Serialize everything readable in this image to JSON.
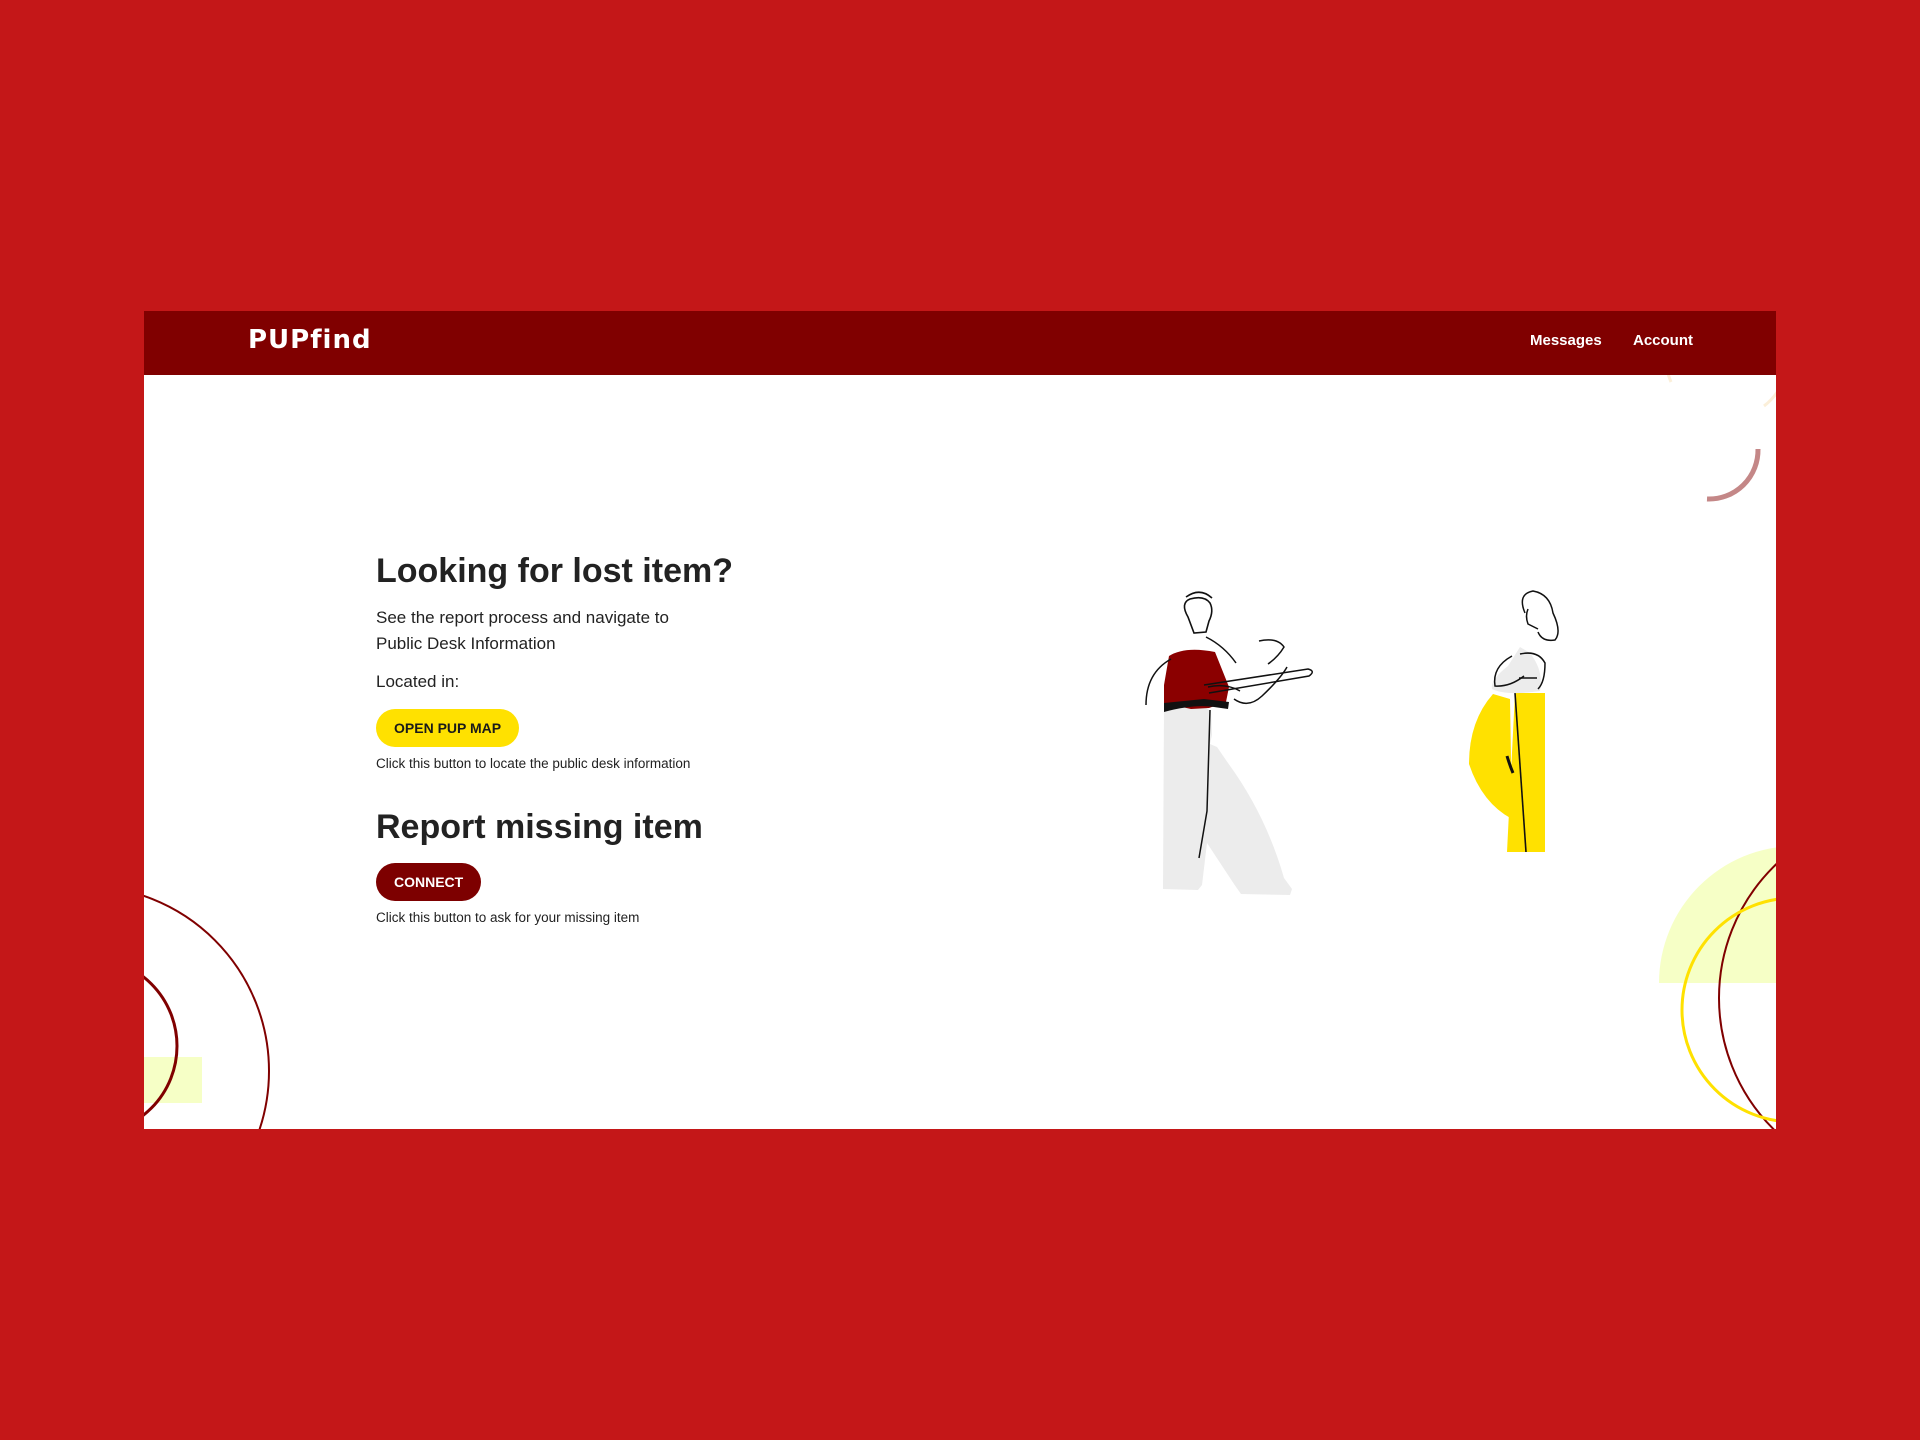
{
  "app": {
    "logo": "PUPfind"
  },
  "nav": {
    "messages": "Messages",
    "account": "Account"
  },
  "lost": {
    "title": "Looking for lost item?",
    "description": "See the report process and navigate to Public Desk Information",
    "located_label": "Located in:",
    "button": "OPEN PUP MAP",
    "hint": "Click this button to locate the public desk information"
  },
  "report": {
    "title": "Report missing item",
    "button": "CONNECT",
    "hint": "Click this button to ask for your missing item"
  },
  "colors": {
    "background": "#C41718",
    "nav": "#800000",
    "accent_yellow": "#FFE100",
    "accent_dark": "#7D0000"
  },
  "icons": {
    "illustration": "people-exchange-illustration"
  }
}
